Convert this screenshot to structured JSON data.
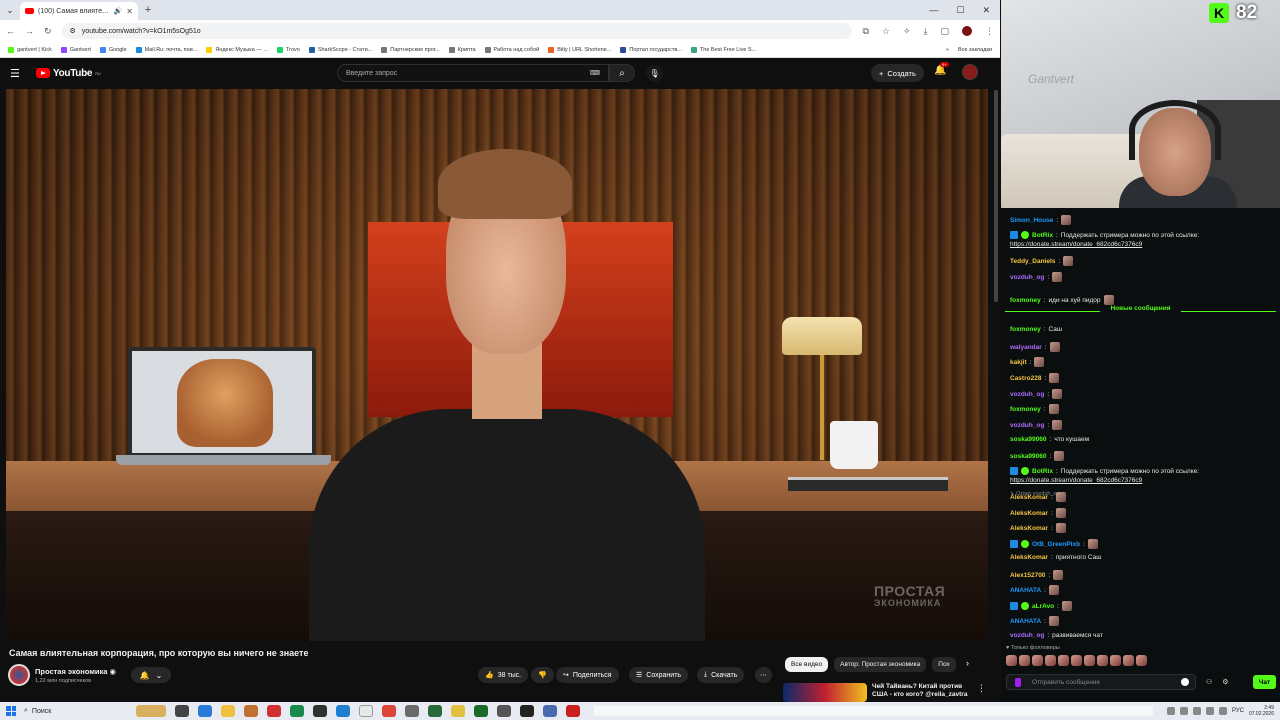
{
  "browser": {
    "tab_title": "(100) Самая влиятельная",
    "new_tab": "+",
    "url": "youtube.com/watch?v=kO1m5sOg51o",
    "bookmarks": [
      {
        "label": "gantvert | Kick",
        "color": "#53fc18"
      },
      {
        "label": "Gantvert",
        "color": "#9146ff"
      },
      {
        "label": "Google",
        "color": "#4285f4"
      },
      {
        "label": "Mail.Ru: почта, пои...",
        "color": "#168de2"
      },
      {
        "label": "Яндекс Музыка — ...",
        "color": "#ffcc00"
      },
      {
        "label": "Trovo",
        "color": "#19d66b"
      },
      {
        "label": "SharkScope - Стати...",
        "color": "#1f5fa8"
      },
      {
        "label": "Партнерские прог...",
        "color": "#777777"
      },
      {
        "label": "Крипта",
        "color": "#777777"
      },
      {
        "label": "Работа над собой",
        "color": "#777777"
      },
      {
        "label": "Bitly | URL Shortene...",
        "color": "#ee6123"
      },
      {
        "label": "Портал государств...",
        "color": "#2b4a9c"
      },
      {
        "label": "The Best Free Live S...",
        "color": "#3aa57c"
      }
    ],
    "all_bookmarks": "Все закладки"
  },
  "youtube": {
    "logo": "YouTube",
    "logo_region": "RU",
    "search_placeholder": "Введите запрос",
    "create_label": "Создать",
    "notifications_badge": "9+",
    "video_title": "Самая влиятельная корпорация, про которую вы ничего не знаете",
    "channel_name": "Простая экономика",
    "subscribers": "1,22 млн подписчиков",
    "likes": "38 тыс.",
    "share": "Поделиться",
    "save": "Сохранить",
    "download": "Скачать",
    "watermark_line1": "ПРОСТАЯ",
    "watermark_line2": "ЭКОНОМИКА",
    "chips": [
      "Все видео",
      "Автор: Простая экономика",
      "Пох"
    ],
    "rec_title": "Чей Тайвань? Китай против США - кто кого? @reila_zavtra"
  },
  "stream": {
    "viewers": "82",
    "cam_label": "Gantvert",
    "platform_icon": "K"
  },
  "chat": {
    "messages": [
      {
        "user": "Simon_House",
        "color": "#1e9bff",
        "text": "",
        "emote": true
      },
      {
        "user": "BotRix",
        "color": "#53fc18",
        "text": "Поддержать стримера можно по этой ссылке:",
        "bot": true
      },
      {
        "user": "",
        "color": "#e8e8e8",
        "text": "",
        "link": "https://donate.stream/donate_682cd6c7376c9"
      },
      {
        "user": "Teddy_Daniels",
        "color": "#f5c542",
        "text": "",
        "emote": true
      },
      {
        "user": "vozduh_og",
        "color": "#b06cff",
        "text": "",
        "emote": true
      },
      {
        "user": "foxmoney",
        "color": "#53fc18",
        "text": "иди на хуй пидор",
        "emote": true
      },
      {
        "user": "foxmoney",
        "color": "#53fc18",
        "text": "Саш"
      },
      {
        "user": "walyandar",
        "color": "#b06cff",
        "text": "",
        "emote": true
      },
      {
        "user": "kakjit",
        "color": "#f5c542",
        "text": "",
        "emote": true
      },
      {
        "user": "Castro228",
        "color": "#f5c542",
        "text": "",
        "emote": true
      },
      {
        "user": "vozduh_og",
        "color": "#b06cff",
        "text": "",
        "emote": true
      },
      {
        "user": "foxmoney",
        "color": "#53fc18",
        "text": "",
        "emote": true
      },
      {
        "user": "vozduh_og",
        "color": "#b06cff",
        "text": "",
        "emote": true
      },
      {
        "user": "soska99060",
        "color": "#53fc18",
        "text": "что кушаем"
      },
      {
        "user": "soska99060",
        "color": "#53fc18",
        "text": "",
        "emote": true
      },
      {
        "user": "BotRix",
        "color": "#53fc18",
        "text": "Поддержать стримера можно по этой ссылке:",
        "bot": true
      },
      {
        "user": "",
        "color": "#e8e8e8",
        "text": "",
        "link": "https://donate.stream/donate_682cd6c7376c9"
      },
      {
        "user": "AleksKomar",
        "color": "#f5c542",
        "text": "",
        "emote": true
      },
      {
        "user": "AleksKomar",
        "color": "#f5c542",
        "text": "",
        "emote": true
      },
      {
        "user": "AleksKomar",
        "color": "#f5c542",
        "text": "",
        "emote": true
      },
      {
        "user": "OtB_GreenPixb",
        "color": "#1e9bff",
        "text": "",
        "emote": true,
        "bot": true
      },
      {
        "user": "AleksKomar",
        "color": "#f5c542",
        "text": "приятного Саш"
      },
      {
        "user": "Alex152700",
        "color": "#f5c542",
        "text": "",
        "emote": true
      },
      {
        "user": "ANAHATA",
        "color": "#1e9bff",
        "text": "",
        "emote": true
      },
      {
        "user": "aLrAvo",
        "color": "#53fc18",
        "text": "",
        "emote": true,
        "bot": true
      },
      {
        "user": "ANAHATA",
        "color": "#1e9bff",
        "text": "",
        "emote": true
      },
      {
        "user": "vozduh_og",
        "color": "#b06cff",
        "text": "развиваемся чат"
      }
    ],
    "reply_hint": "Ответ vozduh_og:",
    "new_messages": "Новые сообщения",
    "followers_label": "Только фолловеры",
    "input_placeholder": "Отправить сообщение",
    "send_label": "Чат"
  },
  "taskbar": {
    "search": "Поиск",
    "lang": "РУС",
    "time": "2:49",
    "date": "07.02.2026"
  }
}
